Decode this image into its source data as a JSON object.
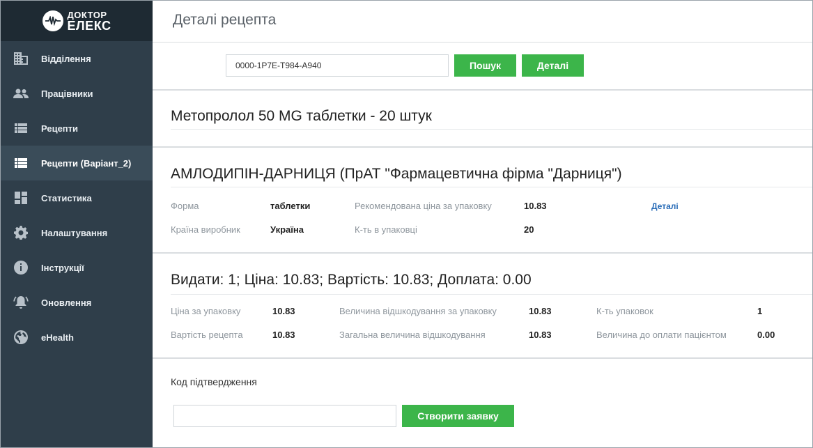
{
  "brand": {
    "line1": "ДОКТОР",
    "line2": "ЕЛЕКС"
  },
  "sidebar": {
    "items": [
      {
        "label": "Відділення",
        "icon": "building-icon"
      },
      {
        "label": "Працівники",
        "icon": "people-icon"
      },
      {
        "label": "Рецепти",
        "icon": "list-icon"
      },
      {
        "label": "Рецепти (Варіант_2)",
        "icon": "list-icon",
        "active": true
      },
      {
        "label": "Статистика",
        "icon": "dashboard-icon"
      },
      {
        "label": "Налаштування",
        "icon": "gear-icon"
      },
      {
        "label": "Інструкції",
        "icon": "info-icon"
      },
      {
        "label": "Оновлення",
        "icon": "bell-icon"
      },
      {
        "label": "eHealth",
        "icon": "globe-icon"
      }
    ]
  },
  "page": {
    "title": "Деталі рецепта"
  },
  "search": {
    "value": "0000-1P7E-T984-A940",
    "search_label": "Пошук",
    "details_label": "Деталі"
  },
  "prescription": {
    "title": "Метопролол 50 MG таблетки - 20 штук"
  },
  "drug": {
    "title": "АМЛОДИПІН-ДАРНИЦЯ (ПрАТ \"Фармацевтична фірма \"Дарниця\")",
    "form_label": "Форма",
    "form_value": "таблетки",
    "recommended_price_label": "Рекомендована ціна за упаковку",
    "recommended_price_value": "10.83",
    "details_link": "Деталі",
    "country_label": "Країна виробник",
    "country_value": "Україна",
    "pack_count_label": "К-ть в упаковці",
    "pack_count_value": "20"
  },
  "dispense": {
    "summary": "Видати: 1; Ціна: 10.83; Вартість: 10.83; Доплата: 0.00",
    "price_per_pack_label": "Ціна за упаковку",
    "price_per_pack_value": "10.83",
    "reimb_per_pack_label": "Величина відшкодування за упаковку",
    "reimb_per_pack_value": "10.83",
    "packs_label": "К-ть упаковок",
    "packs_value": "1",
    "rx_cost_label": "Вартість рецепта",
    "rx_cost_value": "10.83",
    "total_reimb_label": "Загальна величина відшкодування",
    "total_reimb_value": "10.83",
    "patient_pay_label": "Величина до оплати пацієнтом",
    "patient_pay_value": "0.00"
  },
  "confirmation": {
    "label": "Код підтвердження",
    "code_value": "",
    "create_label": "Створити заявку"
  },
  "colors": {
    "sidebar_bg": "#2f3e4a",
    "sidebar_header_bg": "#1e2a33",
    "sidebar_active_bg": "#3a4c59",
    "accent_green": "#3cb54a",
    "link_blue": "#2a6db8"
  }
}
